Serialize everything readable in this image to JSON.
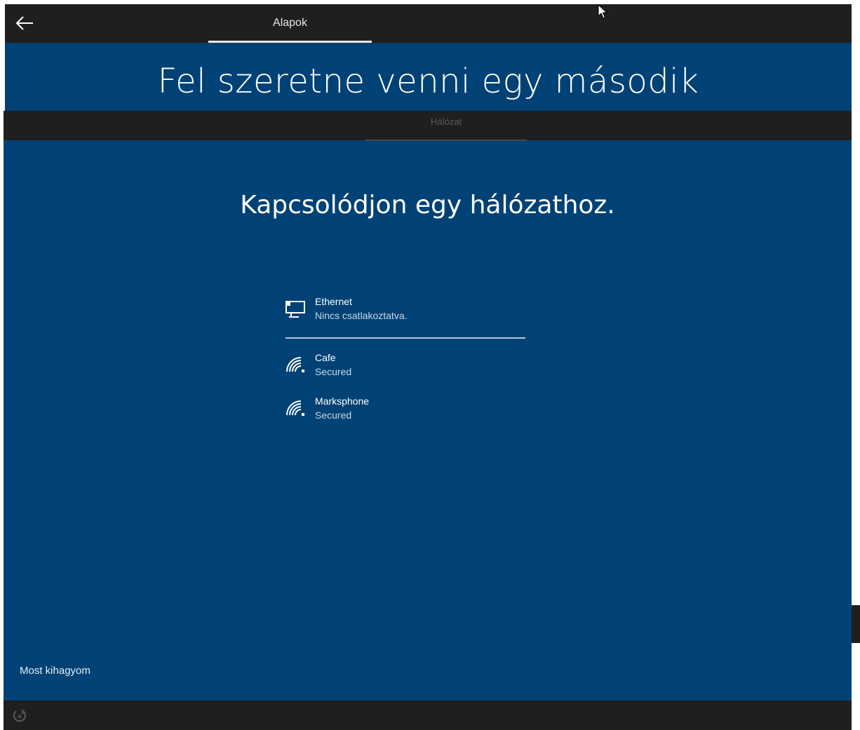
{
  "background_window": {
    "back_button_icon": "back-arrow-icon",
    "tab_label": "Alapok",
    "heading": "Fel szeretne venni egy második"
  },
  "window": {
    "tab_label": "Hálózat",
    "heading": "Kapcsolódjon egy hálózathoz.",
    "networks": [
      {
        "icon": "ethernet-icon",
        "name": "Ethernet",
        "status": "Nincs csatlakoztatva."
      },
      {
        "icon": "wifi-icon",
        "name": "Cafe",
        "status": "Secured"
      },
      {
        "icon": "wifi-icon",
        "name": "Marksphone",
        "status": "Secured"
      }
    ],
    "skip_label": "Most kihagyom",
    "bottom_icon": "accessibility-icon"
  },
  "colors": {
    "background_blue": "#004275",
    "bar_dark": "#1f1f1f",
    "text": "#ffffff"
  }
}
